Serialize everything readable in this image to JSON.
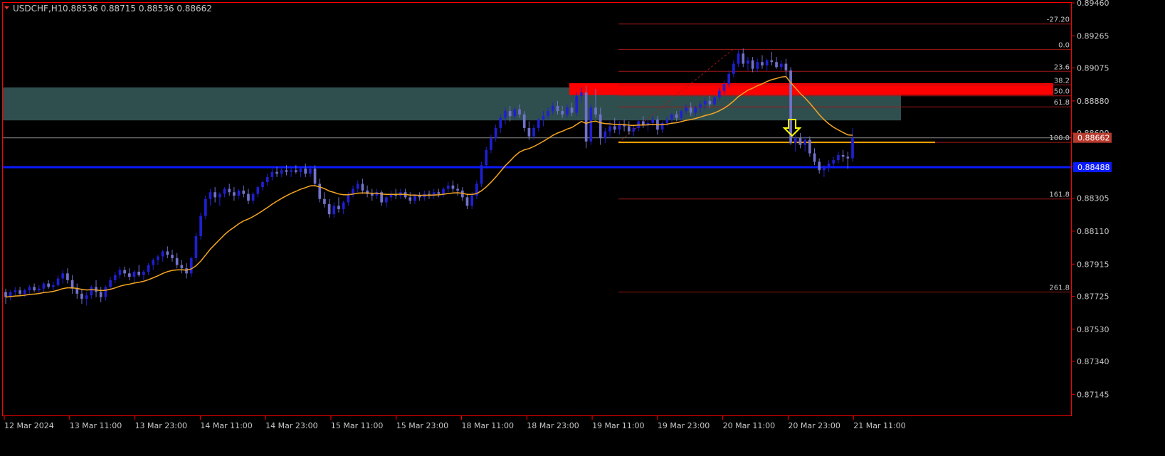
{
  "header": {
    "symbol": "USDCHF,H1",
    "ohlc": "0.88536 0.88715 0.88536 0.88662"
  },
  "colors": {
    "background": "#000000",
    "axis": "#ff0000",
    "bull_candle": "#1f1fd2",
    "bear_candle": "#7272cc",
    "moving_average": "#f5a623",
    "horizontal_line": "#0a1aff",
    "zone_fill": "#2f4f4f",
    "red_zone": "#ff0000",
    "fib_line": "#a01818",
    "orange_line": "#ffa500",
    "arrow": "#ffff00",
    "price_badge": "#b83a2e",
    "blue_badge": "#0a1aff",
    "text": "#c8c8c8"
  },
  "chart_data": {
    "type": "candlestick",
    "ylim": [
      0.8702,
      0.8946
    ],
    "y_ticks": [
      "0.89460",
      "0.89265",
      "0.89075",
      "0.88880",
      "0.88690",
      "0.88495",
      "0.88305",
      "0.88110",
      "0.87915",
      "0.87725",
      "0.87530",
      "0.87340",
      "0.87145"
    ],
    "x_ticks": [
      "12 Mar 2024",
      "13 Mar 11:00",
      "13 Mar 23:00",
      "14 Mar 11:00",
      "14 Mar 23:00",
      "15 Mar 11:00",
      "15 Mar 23:00",
      "18 Mar 11:00",
      "18 Mar 23:00",
      "19 Mar 11:00",
      "19 Mar 23:00",
      "20 Mar 11:00",
      "20 Mar 23:00",
      "21 Mar 11:00"
    ],
    "current_price": "0.88662",
    "blue_line_price": "0.88488",
    "fibonacci": {
      "levels": [
        {
          "label": "-27.20",
          "price": 0.89335
        },
        {
          "label": "0.0",
          "price": 0.89185
        },
        {
          "label": "23.6",
          "price": 0.89055
        },
        {
          "label": "38.2",
          "price": 0.88975
        },
        {
          "label": "50.0",
          "price": 0.8891
        },
        {
          "label": "61.8",
          "price": 0.88845
        },
        {
          "label": "100.0",
          "price": 0.88635
        },
        {
          "label": "161.8",
          "price": 0.883
        },
        {
          "label": "261.8",
          "price": 0.8775
        }
      ]
    },
    "zones": {
      "teal": {
        "top": 0.8896,
        "bottom": 0.88765
      },
      "red": {
        "top": 0.88985,
        "bottom": 0.88915
      }
    },
    "candles": [
      [
        0.8775,
        0.8777,
        0.8768,
        0.8772
      ],
      [
        0.8772,
        0.8776,
        0.877,
        0.8775
      ],
      [
        0.8775,
        0.8778,
        0.8773,
        0.8776
      ],
      [
        0.8776,
        0.8778,
        0.8773,
        0.8774
      ],
      [
        0.8774,
        0.8777,
        0.8772,
        0.8776
      ],
      [
        0.8776,
        0.8779,
        0.8774,
        0.8778
      ],
      [
        0.8778,
        0.878,
        0.8775,
        0.8776
      ],
      [
        0.8776,
        0.8779,
        0.8774,
        0.8777
      ],
      [
        0.8777,
        0.8781,
        0.8775,
        0.878
      ],
      [
        0.878,
        0.8782,
        0.8777,
        0.8778
      ],
      [
        0.8778,
        0.8781,
        0.8776,
        0.8779
      ],
      [
        0.8779,
        0.8785,
        0.8778,
        0.8783
      ],
      [
        0.8783,
        0.8788,
        0.878,
        0.8786
      ],
      [
        0.8786,
        0.8789,
        0.878,
        0.8782
      ],
      [
        0.8782,
        0.8785,
        0.8774,
        0.8777
      ],
      [
        0.8777,
        0.878,
        0.8771,
        0.8774
      ],
      [
        0.8774,
        0.8777,
        0.8768,
        0.8771
      ],
      [
        0.8771,
        0.8775,
        0.8767,
        0.8773
      ],
      [
        0.8773,
        0.8779,
        0.8771,
        0.8778
      ],
      [
        0.8778,
        0.8782,
        0.8772,
        0.8775
      ],
      [
        0.8775,
        0.8778,
        0.8769,
        0.8772
      ],
      [
        0.8772,
        0.8779,
        0.877,
        0.8778
      ],
      [
        0.8778,
        0.8784,
        0.8776,
        0.8782
      ],
      [
        0.8782,
        0.8787,
        0.878,
        0.8785
      ],
      [
        0.8785,
        0.879,
        0.8783,
        0.8788
      ],
      [
        0.8788,
        0.879,
        0.8784,
        0.8786
      ],
      [
        0.8786,
        0.8789,
        0.8782,
        0.8784
      ],
      [
        0.8784,
        0.8788,
        0.8781,
        0.8787
      ],
      [
        0.8787,
        0.8791,
        0.8784,
        0.8785
      ],
      [
        0.8785,
        0.8788,
        0.8782,
        0.8787
      ],
      [
        0.8787,
        0.8792,
        0.8785,
        0.8791
      ],
      [
        0.8791,
        0.8795,
        0.8788,
        0.8794
      ],
      [
        0.8794,
        0.8797,
        0.8791,
        0.8796
      ],
      [
        0.8796,
        0.88,
        0.8793,
        0.8799
      ],
      [
        0.8799,
        0.8802,
        0.8795,
        0.8797
      ],
      [
        0.8797,
        0.88,
        0.8793,
        0.8795
      ],
      [
        0.8795,
        0.8798,
        0.8789,
        0.8791
      ],
      [
        0.8791,
        0.8794,
        0.8786,
        0.8789
      ],
      [
        0.8789,
        0.8792,
        0.8783,
        0.8786
      ],
      [
        0.8786,
        0.8796,
        0.8784,
        0.8795
      ],
      [
        0.8795,
        0.881,
        0.8793,
        0.8808
      ],
      [
        0.8808,
        0.8822,
        0.8806,
        0.882
      ],
      [
        0.882,
        0.8832,
        0.8818,
        0.883
      ],
      [
        0.883,
        0.8836,
        0.8826,
        0.8834
      ],
      [
        0.8834,
        0.8837,
        0.8828,
        0.8831
      ],
      [
        0.8831,
        0.8834,
        0.8826,
        0.8833
      ],
      [
        0.8833,
        0.8837,
        0.8831,
        0.8836
      ],
      [
        0.8836,
        0.8839,
        0.8832,
        0.8834
      ],
      [
        0.8834,
        0.8837,
        0.8829,
        0.8832
      ],
      [
        0.8832,
        0.8836,
        0.883,
        0.8835
      ],
      [
        0.8835,
        0.8838,
        0.8831,
        0.8833
      ],
      [
        0.8833,
        0.8836,
        0.8827,
        0.8829
      ],
      [
        0.8829,
        0.8834,
        0.8827,
        0.8833
      ],
      [
        0.8833,
        0.8838,
        0.8831,
        0.8837
      ],
      [
        0.8837,
        0.8841,
        0.8835,
        0.884
      ],
      [
        0.884,
        0.8845,
        0.8838,
        0.8843
      ],
      [
        0.8843,
        0.8848,
        0.8841,
        0.8846
      ],
      [
        0.8846,
        0.8849,
        0.8843,
        0.8845
      ],
      [
        0.8845,
        0.8849,
        0.8843,
        0.8847
      ],
      [
        0.8847,
        0.885,
        0.8844,
        0.8846
      ],
      [
        0.8846,
        0.8849,
        0.8843,
        0.8847
      ],
      [
        0.8847,
        0.885,
        0.8845,
        0.8846
      ],
      [
        0.8846,
        0.8849,
        0.8843,
        0.8848
      ],
      [
        0.8848,
        0.8851,
        0.8843,
        0.8845
      ],
      [
        0.8845,
        0.885,
        0.8843,
        0.8848
      ],
      [
        0.8848,
        0.885,
        0.8838,
        0.8839
      ],
      [
        0.8839,
        0.8842,
        0.8828,
        0.883
      ],
      [
        0.883,
        0.8834,
        0.8825,
        0.8827
      ],
      [
        0.8827,
        0.883,
        0.8819,
        0.8821
      ],
      [
        0.8821,
        0.8828,
        0.8819,
        0.8826
      ],
      [
        0.8826,
        0.8831,
        0.8822,
        0.8824
      ],
      [
        0.8824,
        0.8829,
        0.8821,
        0.8828
      ],
      [
        0.8828,
        0.8834,
        0.8826,
        0.8833
      ],
      [
        0.8833,
        0.8838,
        0.8831,
        0.8836
      ],
      [
        0.8836,
        0.8841,
        0.8834,
        0.8839
      ],
      [
        0.8839,
        0.8842,
        0.8833,
        0.8835
      ],
      [
        0.8835,
        0.8838,
        0.8831,
        0.8833
      ],
      [
        0.8833,
        0.8836,
        0.8829,
        0.8832
      ],
      [
        0.8832,
        0.8836,
        0.883,
        0.8834
      ],
      [
        0.8834,
        0.8835,
        0.8826,
        0.8828
      ],
      [
        0.8828,
        0.8832,
        0.8825,
        0.8831
      ],
      [
        0.8831,
        0.8835,
        0.8829,
        0.8833
      ],
      [
        0.8833,
        0.8836,
        0.883,
        0.8832
      ],
      [
        0.8832,
        0.8836,
        0.883,
        0.8834
      ],
      [
        0.8834,
        0.8836,
        0.883,
        0.8831
      ],
      [
        0.8831,
        0.8834,
        0.8827,
        0.8829
      ],
      [
        0.8829,
        0.8833,
        0.8827,
        0.8832
      ],
      [
        0.8832,
        0.8834,
        0.8829,
        0.8831
      ],
      [
        0.8831,
        0.8835,
        0.8829,
        0.8833
      ],
      [
        0.8833,
        0.8835,
        0.883,
        0.8832
      ],
      [
        0.8832,
        0.8836,
        0.883,
        0.8834
      ],
      [
        0.8834,
        0.8836,
        0.8831,
        0.8833
      ],
      [
        0.8833,
        0.8837,
        0.8831,
        0.8836
      ],
      [
        0.8836,
        0.884,
        0.8834,
        0.8838
      ],
      [
        0.8838,
        0.8841,
        0.8834,
        0.8836
      ],
      [
        0.8836,
        0.8839,
        0.8832,
        0.8835
      ],
      [
        0.8835,
        0.8837,
        0.8829,
        0.8831
      ],
      [
        0.8831,
        0.8833,
        0.8824,
        0.8826
      ],
      [
        0.8826,
        0.8834,
        0.8824,
        0.8832
      ],
      [
        0.8832,
        0.8841,
        0.883,
        0.8839
      ],
      [
        0.8839,
        0.8852,
        0.8837,
        0.885
      ],
      [
        0.885,
        0.8861,
        0.8848,
        0.8859
      ],
      [
        0.8859,
        0.8868,
        0.8857,
        0.8866
      ],
      [
        0.8866,
        0.8874,
        0.8864,
        0.8872
      ],
      [
        0.8872,
        0.888,
        0.8869,
        0.8878
      ],
      [
        0.8878,
        0.8884,
        0.8874,
        0.8882
      ],
      [
        0.8882,
        0.8885,
        0.8876,
        0.8879
      ],
      [
        0.8879,
        0.8884,
        0.8877,
        0.8883
      ],
      [
        0.8883,
        0.8886,
        0.8878,
        0.888
      ],
      [
        0.888,
        0.8882,
        0.887,
        0.8872
      ],
      [
        0.8872,
        0.8876,
        0.8865,
        0.8867
      ],
      [
        0.8867,
        0.8874,
        0.8865,
        0.8872
      ],
      [
        0.8872,
        0.8878,
        0.887,
        0.8877
      ],
      [
        0.8877,
        0.8882,
        0.8873,
        0.8879
      ],
      [
        0.8879,
        0.8884,
        0.8877,
        0.8882
      ],
      [
        0.8882,
        0.8887,
        0.888,
        0.8885
      ],
      [
        0.8885,
        0.8888,
        0.888,
        0.8882
      ],
      [
        0.8882,
        0.8885,
        0.8878,
        0.888
      ],
      [
        0.888,
        0.8886,
        0.8878,
        0.8884
      ],
      [
        0.8884,
        0.8887,
        0.8879,
        0.8881
      ],
      [
        0.8881,
        0.8893,
        0.8879,
        0.8891
      ],
      [
        0.8891,
        0.8896,
        0.8887,
        0.8893
      ],
      [
        0.8893,
        0.8897,
        0.886,
        0.8864
      ],
      [
        0.8864,
        0.8886,
        0.8862,
        0.8884
      ],
      [
        0.8884,
        0.8895,
        0.8878,
        0.888
      ],
      [
        0.888,
        0.8884,
        0.8862,
        0.8866
      ],
      [
        0.8866,
        0.8872,
        0.8863,
        0.887
      ],
      [
        0.887,
        0.8876,
        0.8866,
        0.8873
      ],
      [
        0.8873,
        0.8878,
        0.8869,
        0.8871
      ],
      [
        0.8871,
        0.8876,
        0.8868,
        0.8874
      ],
      [
        0.8874,
        0.8877,
        0.887,
        0.8873
      ],
      [
        0.8873,
        0.8876,
        0.8868,
        0.887
      ],
      [
        0.887,
        0.8874,
        0.8867,
        0.8872
      ],
      [
        0.8872,
        0.8877,
        0.887,
        0.8876
      ],
      [
        0.8876,
        0.8879,
        0.8872,
        0.8874
      ],
      [
        0.8874,
        0.8877,
        0.887,
        0.8875
      ],
      [
        0.8875,
        0.8879,
        0.8873,
        0.8877
      ],
      [
        0.8877,
        0.8879,
        0.8868,
        0.8871
      ],
      [
        0.8871,
        0.8876,
        0.8869,
        0.8875
      ],
      [
        0.8875,
        0.8879,
        0.8873,
        0.8877
      ],
      [
        0.8877,
        0.8881,
        0.8875,
        0.888
      ],
      [
        0.888,
        0.8882,
        0.8876,
        0.8878
      ],
      [
        0.8878,
        0.8883,
        0.8876,
        0.8882
      ],
      [
        0.8882,
        0.8886,
        0.888,
        0.8884
      ],
      [
        0.8884,
        0.8887,
        0.8879,
        0.8881
      ],
      [
        0.8881,
        0.8885,
        0.8879,
        0.8884
      ],
      [
        0.8884,
        0.8888,
        0.8881,
        0.8886
      ],
      [
        0.8886,
        0.889,
        0.8883,
        0.8888
      ],
      [
        0.8888,
        0.8891,
        0.8884,
        0.8886
      ],
      [
        0.8886,
        0.8891,
        0.8885,
        0.889
      ],
      [
        0.889,
        0.8896,
        0.8888,
        0.8894
      ],
      [
        0.8894,
        0.89,
        0.8892,
        0.8898
      ],
      [
        0.8898,
        0.8906,
        0.8896,
        0.8904
      ],
      [
        0.8904,
        0.8912,
        0.8902,
        0.891
      ],
      [
        0.891,
        0.8918,
        0.8908,
        0.8916
      ],
      [
        0.8916,
        0.8919,
        0.8908,
        0.891
      ],
      [
        0.891,
        0.8914,
        0.8906,
        0.8912
      ],
      [
        0.8912,
        0.8914,
        0.8905,
        0.8907
      ],
      [
        0.8907,
        0.8913,
        0.8905,
        0.8911
      ],
      [
        0.8911,
        0.8915,
        0.8907,
        0.8909
      ],
      [
        0.8909,
        0.8913,
        0.8906,
        0.8912
      ],
      [
        0.8912,
        0.8917,
        0.8909,
        0.8911
      ],
      [
        0.8911,
        0.8914,
        0.8907,
        0.8908
      ],
      [
        0.8908,
        0.8912,
        0.8906,
        0.891
      ],
      [
        0.891,
        0.8913,
        0.8903,
        0.8906
      ],
      [
        0.8906,
        0.8908,
        0.8862,
        0.8863
      ],
      [
        0.8863,
        0.8868,
        0.8858,
        0.8866
      ],
      [
        0.8866,
        0.8869,
        0.886,
        0.8862
      ],
      [
        0.8862,
        0.8867,
        0.8858,
        0.8865
      ],
      [
        0.8865,
        0.8867,
        0.8855,
        0.8857
      ],
      [
        0.8857,
        0.886,
        0.885,
        0.8852
      ],
      [
        0.8852,
        0.8854,
        0.8845,
        0.8847
      ],
      [
        0.8847,
        0.885,
        0.8843,
        0.8849
      ],
      [
        0.8849,
        0.8853,
        0.8846,
        0.8851
      ],
      [
        0.8851,
        0.8855,
        0.8848,
        0.8853
      ],
      [
        0.8853,
        0.8858,
        0.8851,
        0.8856
      ],
      [
        0.8856,
        0.8859,
        0.8852,
        0.8855
      ],
      [
        0.8855,
        0.8858,
        0.8848,
        0.8854
      ],
      [
        0.8854,
        0.8872,
        0.8852,
        0.8866
      ]
    ]
  }
}
